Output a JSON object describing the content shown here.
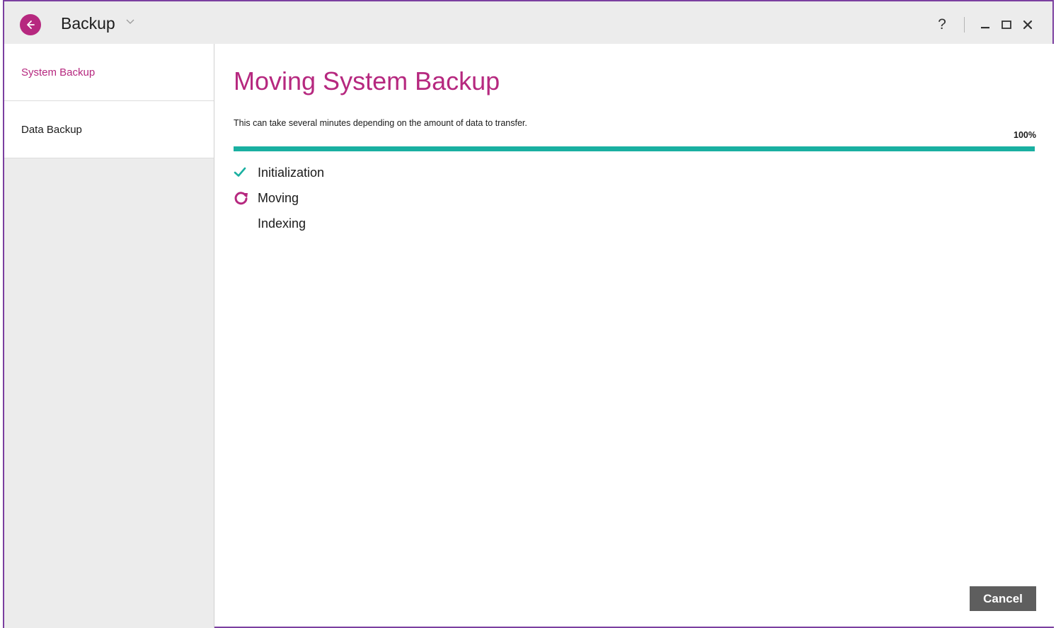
{
  "titlebar": {
    "app_title": "Backup",
    "help_label": "?"
  },
  "sidebar": {
    "items": [
      {
        "label": "System Backup",
        "active": true
      },
      {
        "label": "Data Backup",
        "active": false
      }
    ]
  },
  "main": {
    "title": "Moving System Backup",
    "description": "This can take several minutes depending on the amount of data to transfer.",
    "progress_label": "100%",
    "progress_value": 100,
    "steps": [
      {
        "label": "Initialization",
        "status": "done",
        "icon": "check-icon"
      },
      {
        "label": "Moving",
        "status": "in-progress",
        "icon": "refresh-icon"
      },
      {
        "label": "Indexing",
        "status": "pending",
        "icon": "none"
      }
    ],
    "cancel_label": "Cancel"
  },
  "colors": {
    "accent": "#b6287f",
    "progress": "#1ab0a1",
    "window_border": "#7b3fa0",
    "button": "#5e5e5e"
  }
}
